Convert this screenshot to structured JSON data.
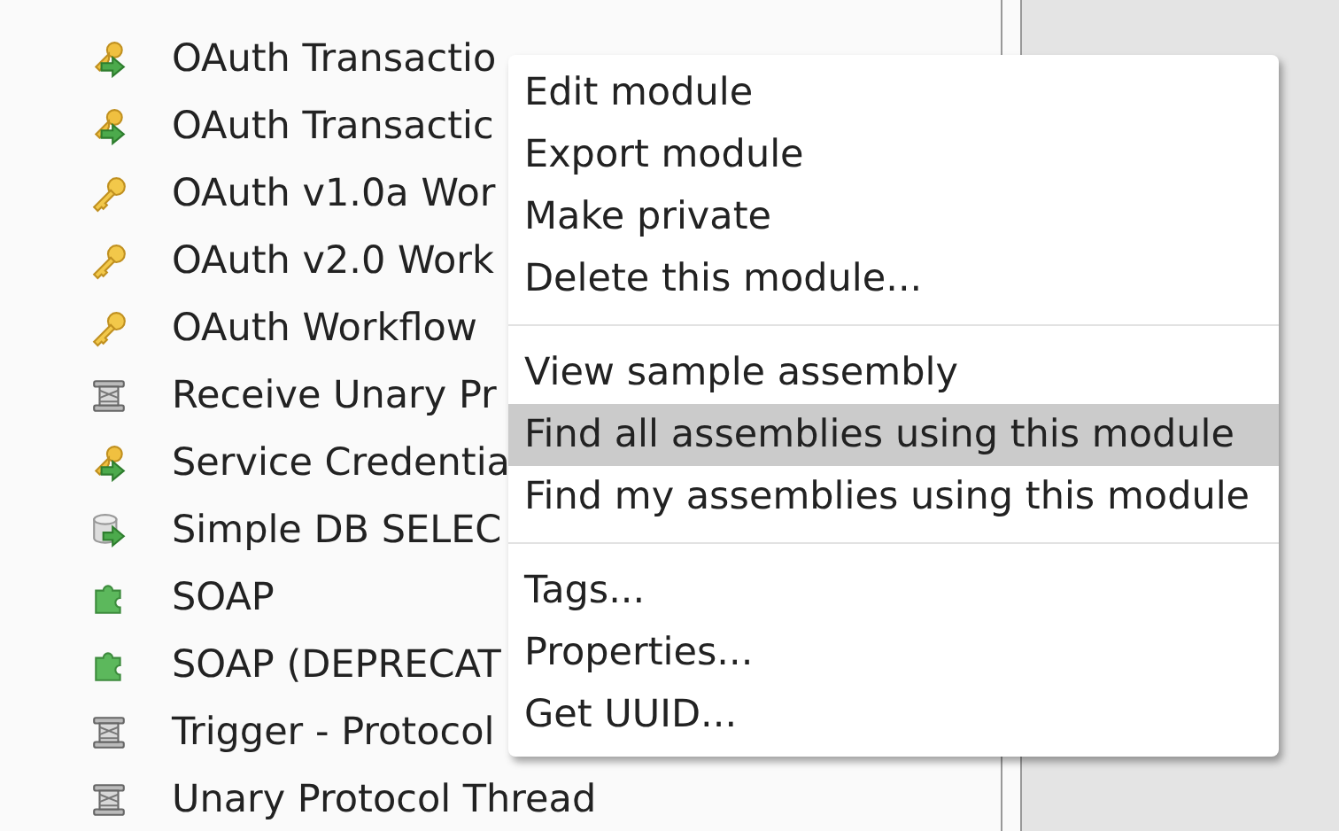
{
  "modules": [
    {
      "kind": "credential",
      "label": "OAuth Transactio"
    },
    {
      "kind": "credential",
      "label": "OAuth Transactic"
    },
    {
      "kind": "workflow",
      "label": "OAuth v1.0a Wor"
    },
    {
      "kind": "workflow",
      "label": "OAuth v2.0 Work"
    },
    {
      "kind": "workflow",
      "label": "OAuth Workflow"
    },
    {
      "kind": "thread",
      "label": "Receive Unary Pr"
    },
    {
      "kind": "credential",
      "label": "Service Credentia"
    },
    {
      "kind": "query",
      "label": "Simple DB SELEC"
    },
    {
      "kind": "service",
      "label": "SOAP"
    },
    {
      "kind": "service",
      "label": "SOAP (DEPRECAT"
    },
    {
      "kind": "thread",
      "label": "Trigger - Protocol"
    },
    {
      "kind": "thread",
      "label": "Unary Protocol Thread"
    }
  ],
  "context_menu": {
    "groups": [
      [
        {
          "label": "Edit module",
          "selected": false
        },
        {
          "label": "Export module",
          "selected": false
        },
        {
          "label": "Make private",
          "selected": false
        },
        {
          "label": "Delete this module...",
          "selected": false
        }
      ],
      [
        {
          "label": "View sample assembly",
          "selected": false
        },
        {
          "label": "Find all assemblies using this module",
          "selected": true
        },
        {
          "label": "Find my assemblies using this module",
          "selected": false
        }
      ],
      [
        {
          "label": "Tags...",
          "selected": false
        },
        {
          "label": "Properties...",
          "selected": false
        },
        {
          "label": "Get UUID...",
          "selected": false
        }
      ]
    ]
  }
}
